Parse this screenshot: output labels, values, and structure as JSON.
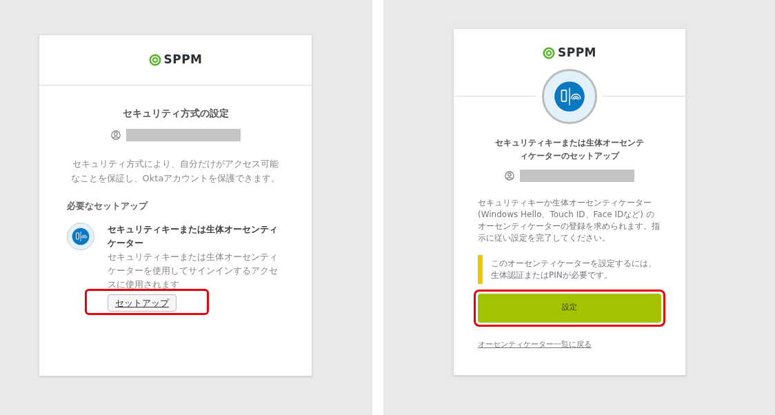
{
  "cards": [
    {
      "kind": "overview",
      "logo": "SPPM",
      "title": "セキュリティ方式の設定",
      "description": "セキュリティ方式により、自分だけがアクセス可能なことを保証し、Oktaアカウントを保護できます。",
      "section_heading": "必要なセットアップ",
      "method": {
        "title": "セキュリティキーまたは生体オーセンティケーター",
        "description": "セキュリティキーまたは生体オーセンティケーターを使用してサインインするアクセスに使用されます",
        "button": "セットアップ",
        "highlighted": true
      }
    },
    {
      "kind": "setup",
      "logo": "SPPM",
      "title": "セキュリティキーまたは生体オーセンティケーターのセットアップ",
      "description": "セキュリティキーか生体オーセンティケーター(Windows Hello、Touch ID、Face IDなど) のオーセンティケーターの登録を求められます。指示に従い設定を完了してください。",
      "notice": "このオーセンティケーターを設定するには、生体認証またはPINが必要です。",
      "button": "設定",
      "highlighted": true,
      "back_link": "オーセンティケーター一覧に戻る"
    }
  ]
}
